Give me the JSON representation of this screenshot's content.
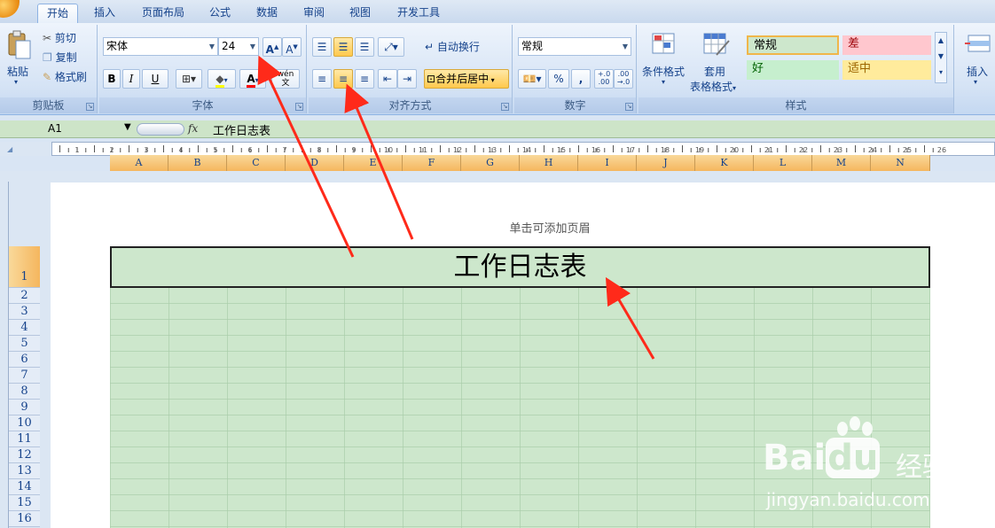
{
  "tabs": [
    "开始",
    "插入",
    "页面布局",
    "公式",
    "数据",
    "审阅",
    "视图",
    "开发工具"
  ],
  "clipboard": {
    "paste": "粘贴",
    "cut": "剪切",
    "copy": "复制",
    "format_painter": "格式刷",
    "label": "剪贴板"
  },
  "font": {
    "name": "宋体",
    "size": "24",
    "bold": "B",
    "italic": "I",
    "underline": "U",
    "label": "字体",
    "phonetic": "wén\n文"
  },
  "alignment": {
    "wrap": "自动换行",
    "merge": "合并后居中",
    "label": "对齐方式"
  },
  "number": {
    "format": "常规",
    "percent": "%",
    "comma": ",",
    "label": "数字",
    "inc": "+.0\n.00",
    "dec": ".00\n→.0"
  },
  "styles": {
    "conditional": "条件格式",
    "table_fmt_1": "套用",
    "table_fmt_2": "表格格式",
    "normal": "常规",
    "bad": "差",
    "good": "好",
    "neutral": "适中",
    "label": "样式"
  },
  "cells": {
    "insert": "插入"
  },
  "formula_bar": {
    "name_box": "A1",
    "fx": "fx",
    "content": "工作日志表"
  },
  "ruler_numbers": [
    "1",
    "2",
    "3",
    "4",
    "5",
    "6",
    "7",
    "8",
    "9",
    "10",
    "11",
    "12",
    "13",
    "14",
    "15",
    "16",
    "17",
    "18",
    "19",
    "20",
    "21",
    "22",
    "23",
    "24",
    "25",
    "26"
  ],
  "columns": [
    "A",
    "B",
    "C",
    "D",
    "E",
    "F",
    "G",
    "H",
    "I",
    "J",
    "K",
    "L",
    "M",
    "N"
  ],
  "rows": [
    "1",
    "2",
    "3",
    "4",
    "5",
    "6",
    "7",
    "8",
    "9",
    "10",
    "11",
    "12",
    "13",
    "14",
    "15",
    "16"
  ],
  "sheet": {
    "header_hint": "单击可添加页眉",
    "title": "工作日志表"
  },
  "watermark": {
    "brand_left": "Bai",
    "brand_right": "du",
    "brand_cn": "经验",
    "url": "jingyan.baidu.com"
  },
  "colors": {
    "accent": "#f5b65e",
    "sheet_fill": "#cde7cc",
    "arrow": "#ff2a1a"
  }
}
